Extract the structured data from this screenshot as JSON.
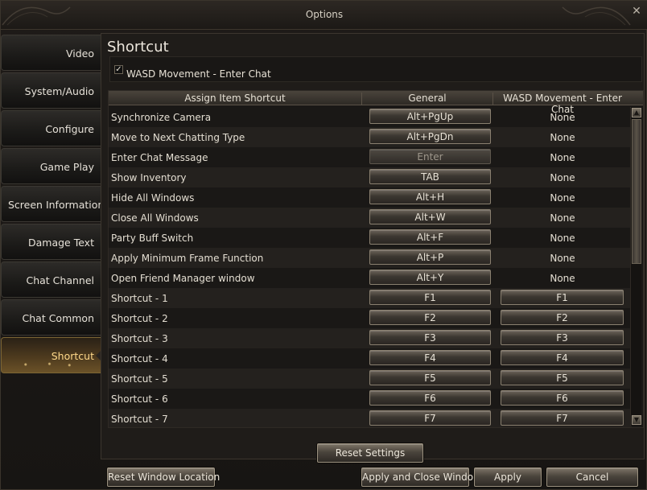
{
  "window": {
    "title": "Options",
    "close_glyph": "✕"
  },
  "sidebar": {
    "items": [
      {
        "label": "Video"
      },
      {
        "label": "System/Audio"
      },
      {
        "label": "Configure"
      },
      {
        "label": "Game Play"
      },
      {
        "label": "Screen Information"
      },
      {
        "label": "Damage Text"
      },
      {
        "label": "Chat Channel"
      },
      {
        "label": "Chat Common"
      },
      {
        "label": "Shortcut"
      }
    ],
    "active": "Shortcut"
  },
  "main": {
    "title": "Shortcut",
    "wasd_checkbox": {
      "label": "WASD Movement - Enter Chat",
      "checked": true,
      "glyph": "✓"
    },
    "table": {
      "headers": [
        "Assign Item Shortcut",
        "General",
        "WASD Movement - Enter Chat"
      ],
      "rows": [
        {
          "label": "Synchronize Camera",
          "general": "Alt+PgUp",
          "wasd": "None"
        },
        {
          "label": "Move to Next Chatting Type",
          "general": "Alt+PgDn",
          "wasd": "None"
        },
        {
          "label": "Enter Chat Message",
          "general": "Enter",
          "wasd": "None"
        },
        {
          "label": "Show Inventory",
          "general": "TAB",
          "wasd": "None"
        },
        {
          "label": "Hide All Windows",
          "general": "Alt+H",
          "wasd": "None"
        },
        {
          "label": "Close All Windows",
          "general": "Alt+W",
          "wasd": "None"
        },
        {
          "label": "Party Buff Switch",
          "general": "Alt+F",
          "wasd": "None"
        },
        {
          "label": "Apply Minimum Frame Function",
          "general": "Alt+P",
          "wasd": "None"
        },
        {
          "label": "Open Friend Manager window",
          "general": "Alt+Y",
          "wasd": "None"
        },
        {
          "label": "Shortcut - 1",
          "general": "F1",
          "wasd": "F1"
        },
        {
          "label": "Shortcut - 2",
          "general": "F2",
          "wasd": "F2"
        },
        {
          "label": "Shortcut - 3",
          "general": "F3",
          "wasd": "F3"
        },
        {
          "label": "Shortcut - 4",
          "general": "F4",
          "wasd": "F4"
        },
        {
          "label": "Shortcut - 5",
          "general": "F5",
          "wasd": "F5"
        },
        {
          "label": "Shortcut - 6",
          "general": "F6",
          "wasd": "F6"
        },
        {
          "label": "Shortcut - 7",
          "general": "F7",
          "wasd": "F7"
        }
      ],
      "scroll_up_glyph": "▲",
      "scroll_down_glyph": "▼"
    },
    "reset_settings_label": "Reset Settings"
  },
  "footer": {
    "reset_window_label": "Reset Window Location",
    "apply_close_label": "Apply and Close Window",
    "apply_label": "Apply",
    "cancel_label": "Cancel"
  }
}
